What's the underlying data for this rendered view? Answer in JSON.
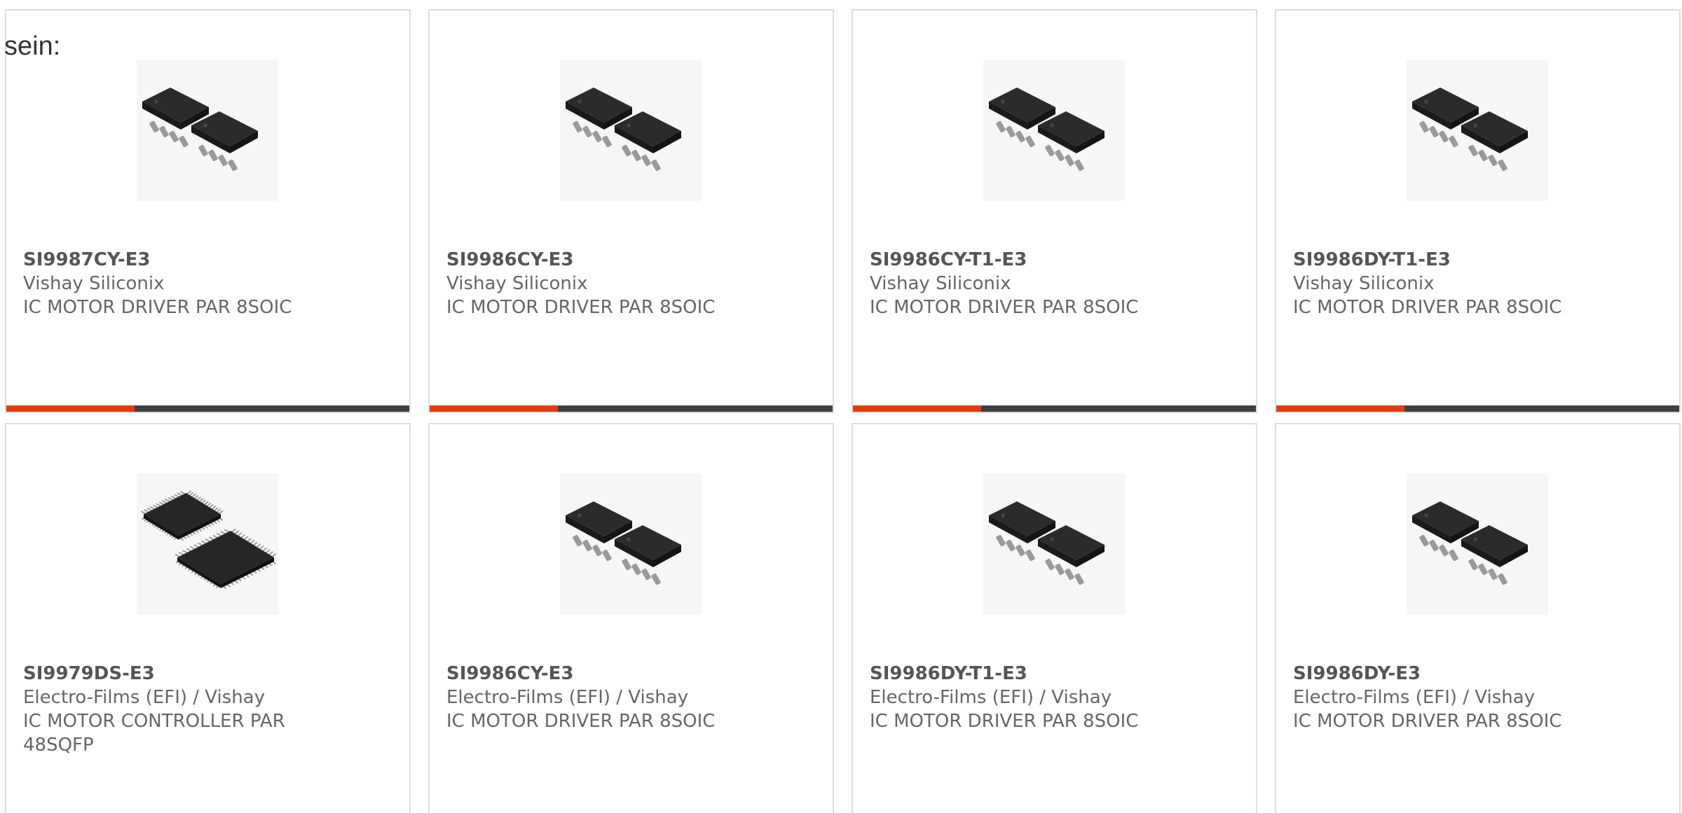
{
  "intro_text": "sein:",
  "colors": {
    "accent": "#e03c14",
    "bar": "#3f3f3f"
  },
  "products": [
    {
      "part": "SI9987CY-E3",
      "maker": "Vishay Siliconix",
      "desc": "IC MOTOR DRIVER PAR 8SOIC",
      "image": "soic8-chip-pair",
      "has_bar": true
    },
    {
      "part": "SI9986CY-E3",
      "maker": "Vishay Siliconix",
      "desc": "IC MOTOR DRIVER PAR 8SOIC",
      "image": "soic8-chip-pair",
      "has_bar": true
    },
    {
      "part": "SI9986CY-T1-E3",
      "maker": "Vishay Siliconix",
      "desc": "IC MOTOR DRIVER PAR 8SOIC",
      "image": "soic8-chip-pair",
      "has_bar": true
    },
    {
      "part": "SI9986DY-T1-E3",
      "maker": "Vishay Siliconix",
      "desc": "IC MOTOR DRIVER PAR 8SOIC",
      "image": "soic8-chip-pair",
      "has_bar": true
    },
    {
      "part": "SI9979DS-E3",
      "maker": "Electro-Films (EFI) / Vishay",
      "desc": "IC MOTOR CONTROLLER PAR 48SQFP",
      "image": "qfp48-chip-pair",
      "has_bar": false
    },
    {
      "part": "SI9986CY-E3",
      "maker": "Electro-Films (EFI) / Vishay",
      "desc": "IC MOTOR DRIVER PAR 8SOIC",
      "image": "soic8-chip-pair",
      "has_bar": false
    },
    {
      "part": "SI9986DY-T1-E3",
      "maker": "Electro-Films (EFI) / Vishay",
      "desc": "IC MOTOR DRIVER PAR 8SOIC",
      "image": "soic8-chip-pair",
      "has_bar": false
    },
    {
      "part": "SI9986DY-E3",
      "maker": "Electro-Films (EFI) / Vishay",
      "desc": "IC MOTOR DRIVER PAR 8SOIC",
      "image": "soic8-chip-pair",
      "has_bar": false
    }
  ]
}
